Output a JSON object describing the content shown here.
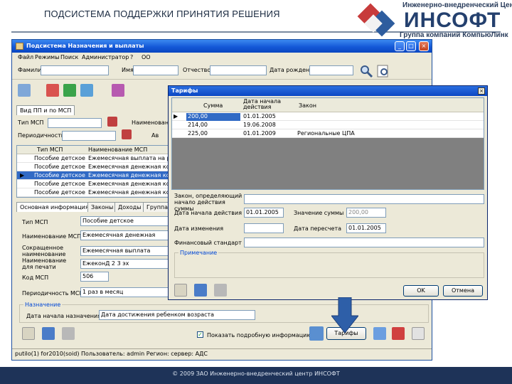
{
  "slide": {
    "title": "ПОДСИСТЕМА ПОДДЕРЖКИ ПРИНЯТИЯ РЕШЕНИЯ",
    "footer": "© 2009 ЗАО Инженерно-внедренческий центр ИНСОФТ"
  },
  "logo": {
    "top": "Инженерно-внедренческий Центр",
    "brand": "ИНСОФТ",
    "sub": "Группа компаний КомпьюЛинк"
  },
  "colors": {
    "titlebar": "#1458d8",
    "selection": "#316ac5",
    "footer": "#1e3358",
    "window_bg": "#ece9d8"
  },
  "main_window": {
    "title": "Подсистема Назначения и выплаты",
    "menu": [
      "Файл",
      "Режимы",
      "Поиск",
      "Администратор",
      "?",
      "OO"
    ],
    "search": {
      "last_name_label": "Фамилия",
      "first_name_label": "Имя",
      "patronymic_label": "Отчество",
      "birth_date_label": "Дата рождения"
    },
    "tabs_top": [
      "Вид ПП и по МСП"
    ],
    "filter_label": "Тип МСП",
    "filter_value": "Наименование",
    "period_label": "Периодичность",
    "period_suffix": "Ав",
    "grid_columns": [
      "Тип МСП",
      "Наименование МСП"
    ],
    "rows": [
      {
        "type": "Пособие детское",
        "name": "Ежемесячная выплата на ребё"
      },
      {
        "type": "Пособие детское",
        "name": "Ежемесячная денежная компе"
      },
      {
        "type": "Пособие детское",
        "name": "Ежемесячная денежная компе"
      },
      {
        "type": "Пособие детское",
        "name": "Ежемесячная денежная компе"
      },
      {
        "type": "Пособие детское",
        "name": "Ежемесячная денежная компе"
      }
    ],
    "detail_tabs": [
      "Основная информация",
      "Законы",
      "Доходы",
      "Группа"
    ],
    "fields": {
      "msp_type_label": "Тип МСП",
      "msp_type_value": "Пособие детское",
      "msp_name_label": "Наименование МСП",
      "msp_name_value": "Ежемесячная денежная",
      "short_name_label": "Сокращенное наименование",
      "short_name_value": "Ежемесячная выплата",
      "print_name_label": "Наименование для печати",
      "print_name_value": "ЕжеконД 2 3 эх",
      "code_label": "Код МСП",
      "code_value": "506",
      "period_label": "Периодичность МСП",
      "period_value": "1 раз в месяц"
    },
    "assignment_group": "Назначение",
    "assignment_start_label": "Дата начала назначения",
    "assignment_start_value": "Дата достижения ребенком возраста",
    "show_details_label": "Показать подробную информацию",
    "tariffs_button": "Тарифы",
    "status_bar": "putilo(1) for2010(soid)   Пользователь: admin   Регион: сервер: АДС"
  },
  "tariffs": {
    "title": "Тарифы",
    "columns": [
      "Сумма",
      "Дата начала действия",
      "Закон"
    ],
    "rows": [
      {
        "sum": "200,00",
        "date": "01.01.2005",
        "law": ""
      },
      {
        "sum": "214,00",
        "date": "19.06.2008",
        "law": ""
      },
      {
        "sum": "225,00",
        "date": "01.01.2009",
        "law": "Региональные ЦПА"
      }
    ],
    "law_label": "Закон, определяющий начало действия суммы",
    "start_label": "Дата начала действия",
    "start_value": "01.01.2005",
    "value_label": "Значение суммы",
    "value_value": "200,00",
    "change_date_label": "Дата изменения",
    "recalc_label": "Дата пересчета",
    "recalc_value": "01.01.2005",
    "financial_label": "Финансовый стандарт",
    "note_group": "Примечание",
    "ok": "OK",
    "cancel": "Отмена"
  }
}
